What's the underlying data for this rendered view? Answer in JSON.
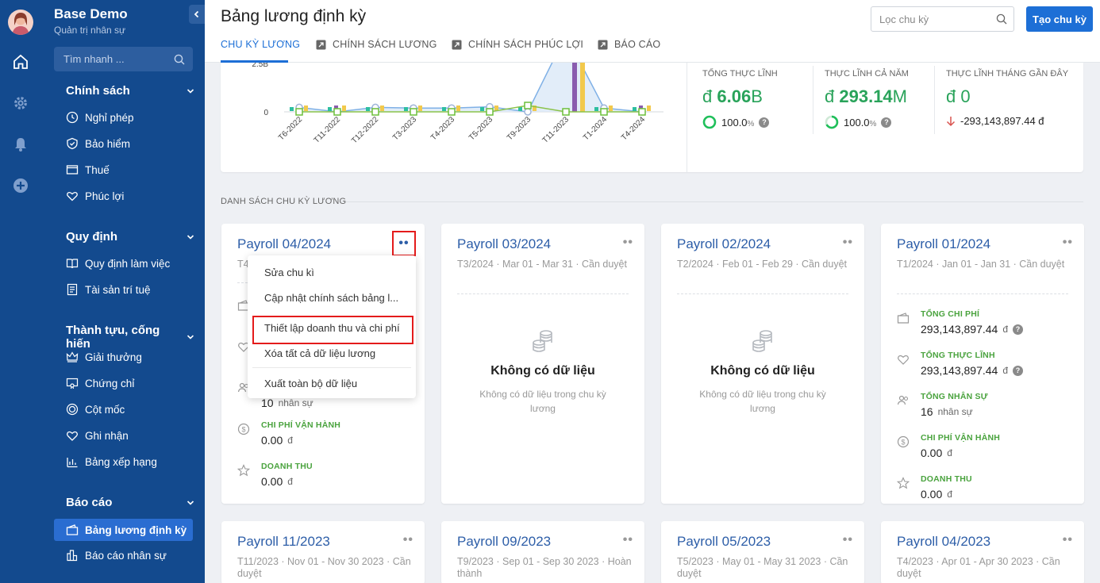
{
  "app": {
    "title": "Base Demo",
    "subtitle": "Quản trị nhân sự",
    "search_placeholder": "Tìm nhanh ..."
  },
  "sidebar": {
    "sections": [
      {
        "label": "Chính sách",
        "items": [
          "Nghỉ phép",
          "Bảo hiểm",
          "Thuế",
          "Phúc lợi"
        ]
      },
      {
        "label": "Quy định",
        "items": [
          "Quy định làm việc",
          "Tài sản trí tuệ"
        ]
      },
      {
        "label": "Thành tựu, cống hiến",
        "items": [
          "Giải thưởng",
          "Chứng chỉ",
          "Cột mốc",
          "Ghi nhận",
          "Bảng xếp hạng"
        ]
      },
      {
        "label": "Báo cáo",
        "items": [
          "Bảng lương định kỳ",
          "Báo cáo nhân sự"
        ]
      }
    ],
    "active_item": "Bảng lương định kỳ"
  },
  "header": {
    "title": "Bảng lương định kỳ",
    "filter_placeholder": "Lọc chu kỳ",
    "create_label": "Tạo chu kỳ",
    "tabs": [
      "CHU KỲ LƯƠNG",
      "CHÍNH SÁCH LƯƠNG",
      "CHÍNH SÁCH PHÚC LỢI",
      "BÁO CÁO"
    ]
  },
  "chart_data": {
    "type": "line",
    "categories": [
      "T6-2022",
      "T11-2022",
      "T12-2022",
      "T3-2023",
      "T4-2023",
      "T5-2023",
      "T9-2023",
      "T11-2023",
      "T1-2024",
      "T4-2024"
    ],
    "y_tick_labels": [
      "2.5B",
      "0"
    ],
    "series": [
      {
        "values": [
          0.35,
          0,
          0.35,
          0.3,
          0.3,
          0.4,
          0,
          6.06,
          0.3,
          0
        ]
      },
      {
        "values": [
          0,
          0,
          0,
          0,
          0,
          0,
          0.5,
          0,
          0,
          0
        ]
      }
    ],
    "bar_colors": [
      "#8a5cae",
      "#f2c94c",
      "#2dbfa0",
      "#e94b8a"
    ]
  },
  "stats": [
    {
      "label": "TỔNG THỰC LĨNH",
      "currency": "đ",
      "amount": "6.06",
      "unit": "B",
      "foot": "100.0",
      "foot_unit": "%"
    },
    {
      "label": "THỰC LĨNH CẢ NĂM",
      "currency": "đ",
      "amount": "293.14",
      "unit": "M",
      "foot": "100.0",
      "foot_unit": "%"
    },
    {
      "label": "THỰC LĨNH THÁNG GẦN ĐÂY",
      "currency": "đ",
      "amount": "0",
      "unit": "",
      "foot": "-293,143,897.44 đ"
    }
  ],
  "list_heading": "DANH SÁCH CHU KỲ LƯƠNG",
  "cards": [
    {
      "title": "Payroll 04/2024",
      "sub": "T4",
      "metrics": [
        {
          "label": "",
          "value": "10",
          "unit": "nhân sự"
        },
        {
          "label": "CHI PHÍ VẬN HÀNH",
          "value": "0.00",
          "unit": "đ"
        },
        {
          "label": "DOANH THU",
          "value": "0.00",
          "unit": "đ"
        }
      ]
    },
    {
      "title": "Payroll 03/2024",
      "sub": "T3/2024 · Mar 01 - Mar 31 · Cần duyệt",
      "empty_title": "Không có dữ liệu",
      "empty_desc": "Không có dữ liệu trong chu kỳ lương"
    },
    {
      "title": "Payroll 02/2024",
      "sub": "T2/2024 · Feb 01 - Feb 29 · Cần duyệt",
      "empty_title": "Không có dữ liệu",
      "empty_desc": "Không có dữ liệu trong chu kỳ lương"
    },
    {
      "title": "Payroll 01/2024",
      "sub": "T1/2024 · Jan 01 - Jan 31 · Cần duyệt",
      "metrics": [
        {
          "label": "TỔNG CHI PHÍ",
          "value": "293,143,897.44",
          "unit": "đ"
        },
        {
          "label": "TỔNG THỰC LĨNH",
          "value": "293,143,897.44",
          "unit": "đ"
        },
        {
          "label": "TỔNG NHÂN SỰ",
          "value": "16",
          "unit": "nhân sự"
        },
        {
          "label": "CHI PHÍ VẬN HÀNH",
          "value": "0.00",
          "unit": "đ"
        },
        {
          "label": "DOANH THU",
          "value": "0.00",
          "unit": "đ"
        }
      ]
    },
    {
      "title": "Payroll 11/2023",
      "sub": "T11/2023 · Nov 01 - Nov 30 2023 · Cần duyệt"
    },
    {
      "title": "Payroll 09/2023",
      "sub": "T9/2023 · Sep 01 - Sep 30 2023 · Hoàn thành"
    },
    {
      "title": "Payroll 05/2023",
      "sub": "T5/2023 · May 01 - May 31 2023 · Cần duyệt"
    },
    {
      "title": "Payroll 04/2023",
      "sub": "T4/2023 · Apr 01 - Apr 30 2023 · Cần duyệt"
    }
  ],
  "dropdown": {
    "items": [
      "Sửa chu kì",
      "Cập nhật chính sách bảng l...",
      "Thiết lập doanh thu và chi phí",
      "Xóa tất cả dữ liệu lương",
      "Xuất toàn bộ dữ liệu"
    ],
    "more_glyph": "••"
  }
}
